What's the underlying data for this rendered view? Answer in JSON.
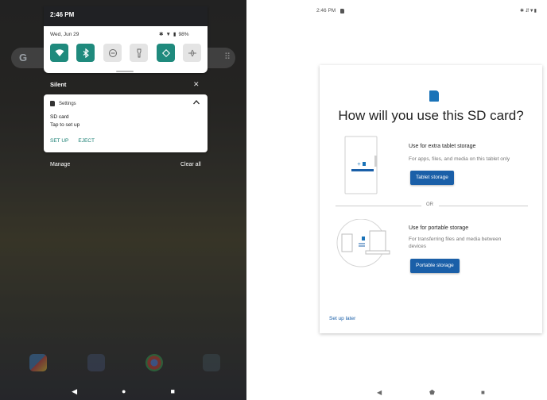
{
  "left_panel": {
    "time": "2:46 PM",
    "date": "Wed, Jun 29",
    "battery": "98%",
    "quick_tiles": [
      {
        "name": "wifi",
        "state": "on"
      },
      {
        "name": "bluetooth",
        "state": "on"
      },
      {
        "name": "do-not-disturb",
        "state": "off"
      },
      {
        "name": "flashlight",
        "state": "off"
      },
      {
        "name": "auto-rotate",
        "state": "on"
      },
      {
        "name": "airplane-mode",
        "state": "off"
      }
    ],
    "section_label": "Silent",
    "notification": {
      "app_name": "Settings",
      "title": "SD card",
      "text": "Tap to set up",
      "actions": [
        "SET UP",
        "EJECT"
      ]
    },
    "manage_label": "Manage",
    "clear_all_label": "Clear all"
  },
  "right_panel": {
    "time": "2:46 PM",
    "title": "How will you use this SD card?",
    "option_tablet": {
      "title": "Use for extra tablet storage",
      "description": "For apps, files, and media on this tablet only",
      "button": "Tablet storage"
    },
    "or_label": "OR",
    "option_portable": {
      "title": "Use for portable storage",
      "description": "For transferring files and media between devices",
      "button": "Portable storage"
    },
    "setup_later": "Set up later"
  },
  "colors": {
    "accent_teal": "#1f8a7d",
    "button_blue": "#1a5fa8",
    "sd_icon_blue": "#1a73b8"
  }
}
